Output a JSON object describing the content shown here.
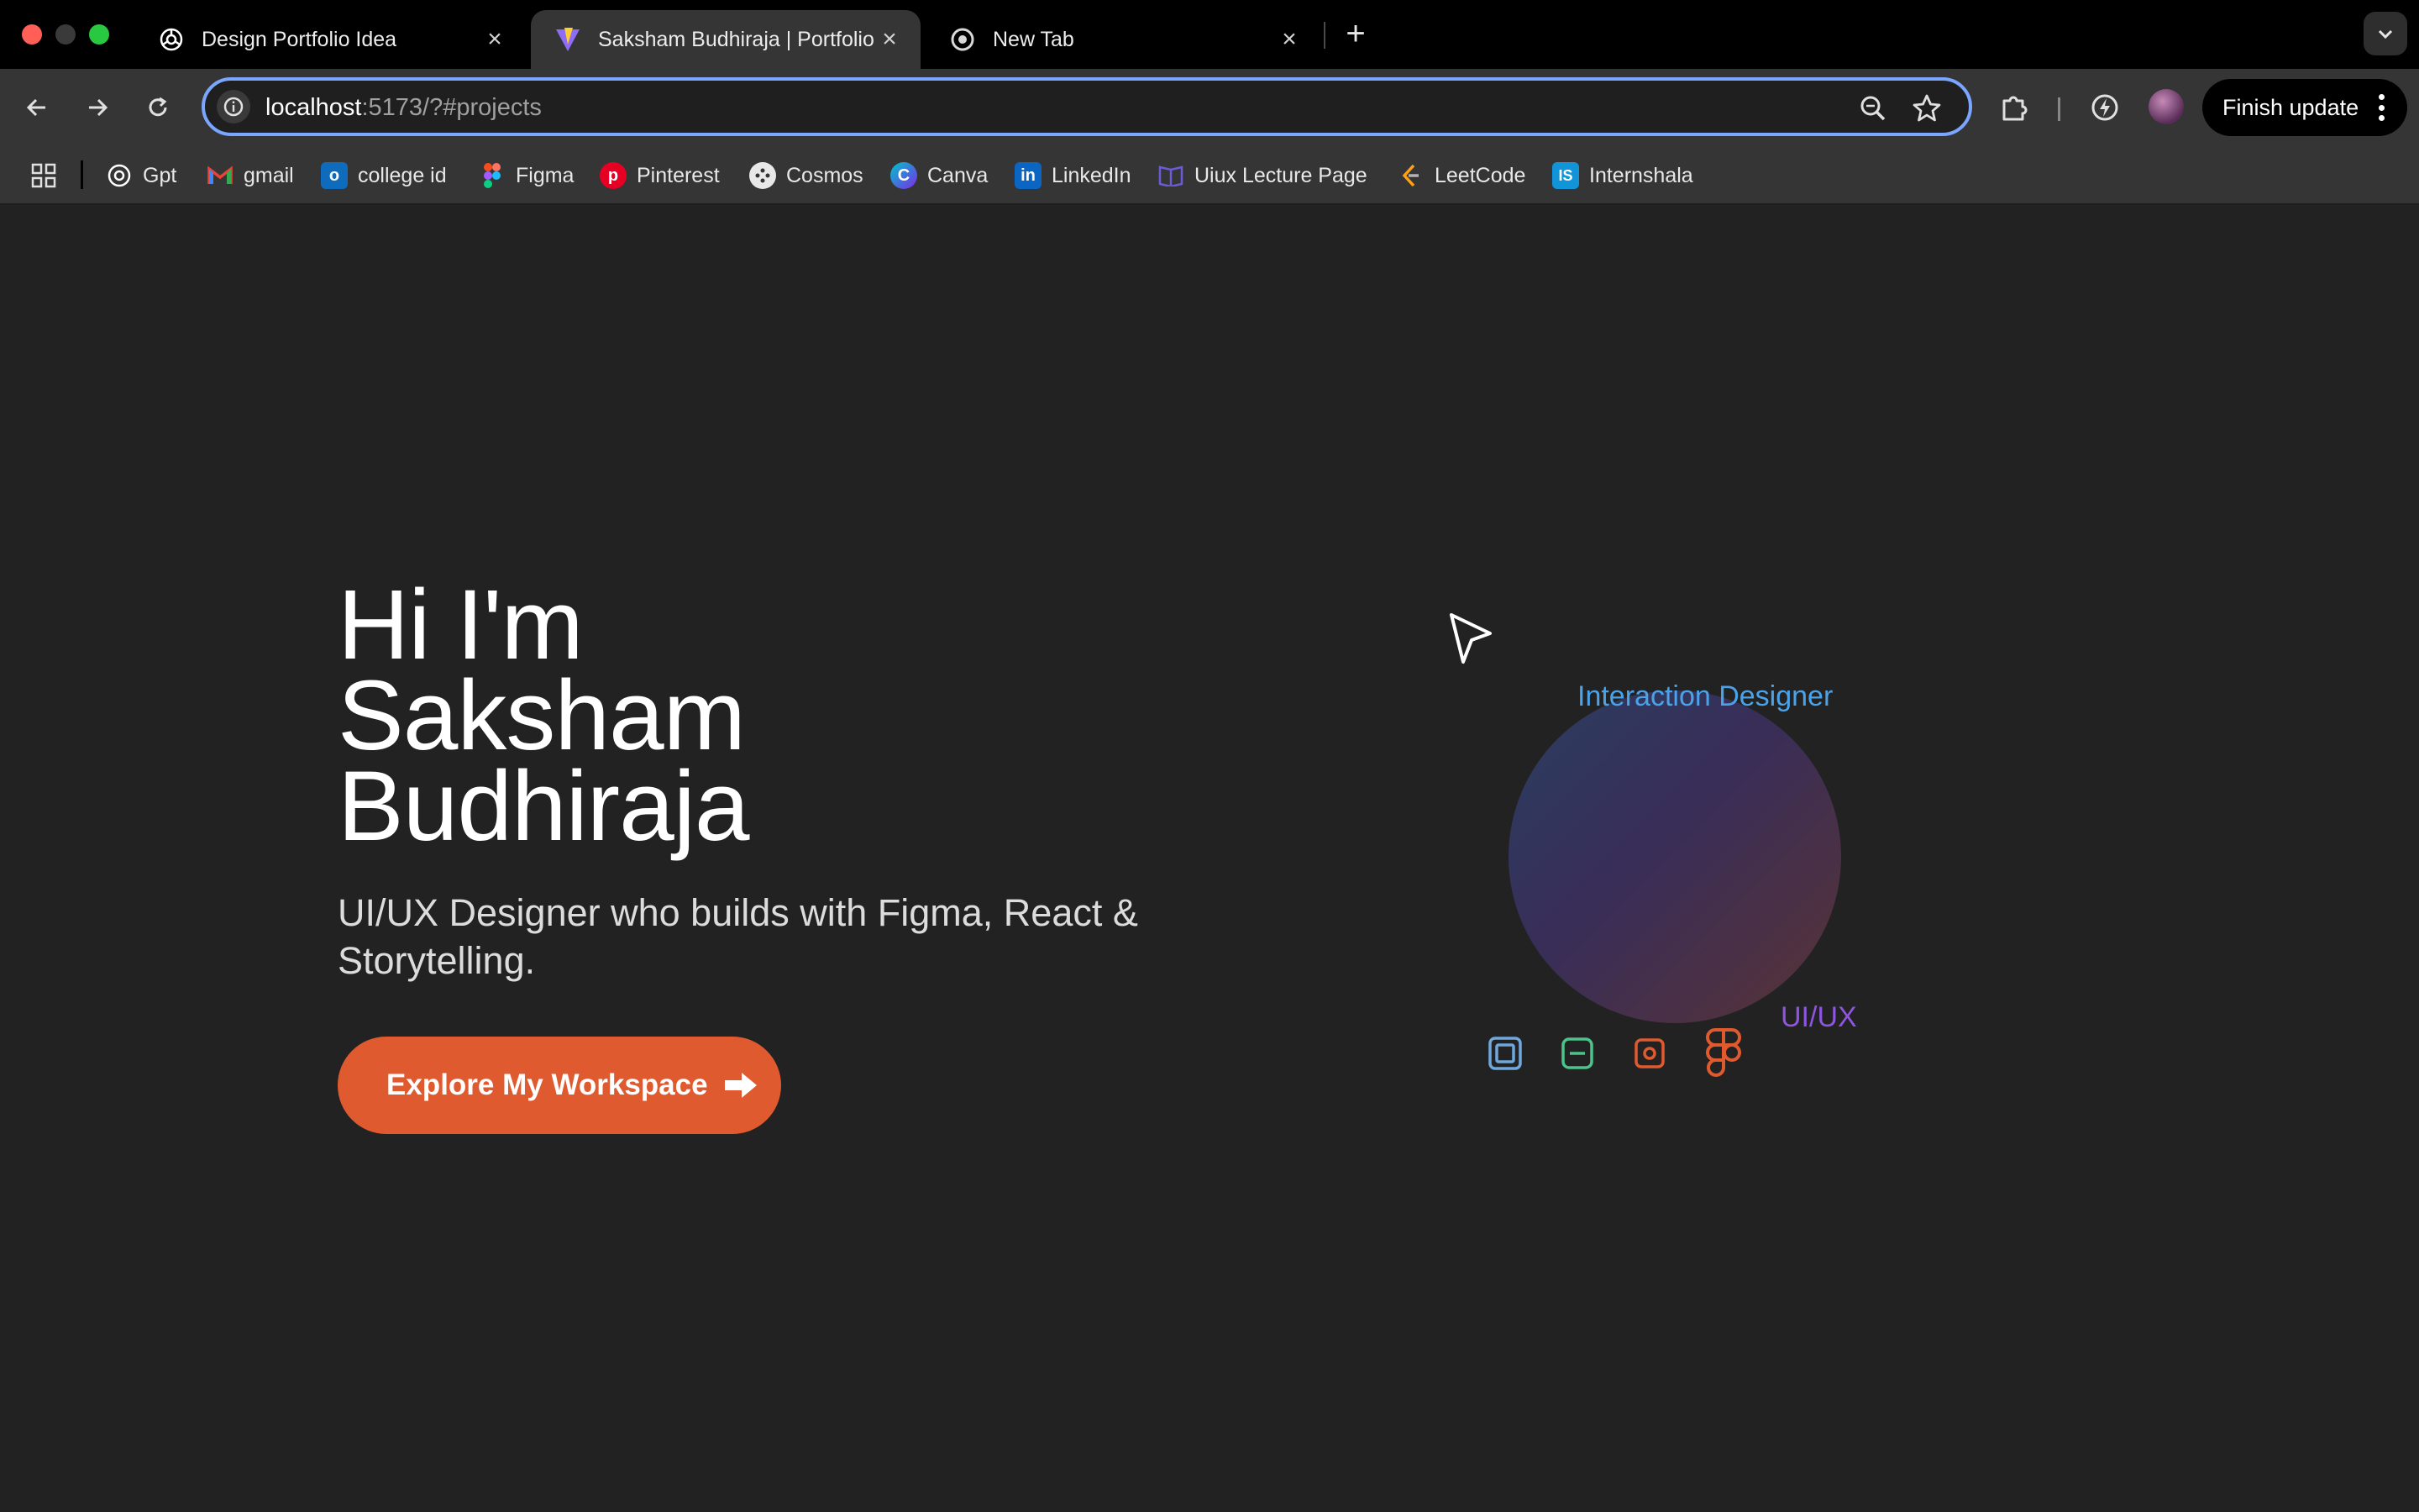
{
  "browser": {
    "tabs": [
      {
        "title": "Design Portfolio Idea",
        "favicon": "openai-icon",
        "active": false
      },
      {
        "title": "Saksham Budhiraja | Portfolio",
        "favicon": "vite-icon",
        "active": true
      },
      {
        "title": "New Tab",
        "favicon": "chrome-icon",
        "active": false
      }
    ],
    "url_host": "localhost",
    "url_rest": ":5173/?#projects",
    "finish_update_label": "Finish update",
    "bookmarks": [
      {
        "label": "Gpt",
        "icon": "openai-icon",
        "color": "#ffffff"
      },
      {
        "label": "gmail",
        "icon": "gmail-icon",
        "color": "#ea4335"
      },
      {
        "label": "college id",
        "icon": "outlook-icon",
        "color": "#0f6cbd"
      },
      {
        "label": "Figma",
        "icon": "figma-icon",
        "color": "#f24e1e"
      },
      {
        "label": "Pinterest",
        "icon": "pinterest-icon",
        "color": "#e60023"
      },
      {
        "label": "Cosmos",
        "icon": "cosmos-icon",
        "color": "#ffffff"
      },
      {
        "label": "Canva",
        "icon": "canva-icon",
        "color": "#7d2ae8"
      },
      {
        "label": "LinkedIn",
        "icon": "linkedin-icon",
        "color": "#0a66c2"
      },
      {
        "label": "Uiux Lecture Page",
        "icon": "book-icon",
        "color": "#6b5bd6"
      },
      {
        "label": "LeetCode",
        "icon": "leetcode-icon",
        "color": "#ffa116"
      },
      {
        "label": "Internshala",
        "icon": "internshala-icon",
        "color": "#1295d8"
      }
    ]
  },
  "hero": {
    "line1": "Hi I'm",
    "line2": "Saksham",
    "line3": "Budhiraja",
    "subtitle": "UI/UX Designer who builds with Figma, React & Storytelling.",
    "cta_label": "Explore My Workspace"
  },
  "visual": {
    "label_top": "Interaction Designer",
    "label_bottom": "UI/UX",
    "tool_icons": [
      {
        "name": "frame-icon",
        "color": "#6fa8dc"
      },
      {
        "name": "component-icon",
        "color": "#4cc38a"
      },
      {
        "name": "target-icon",
        "color": "#e05a2f"
      },
      {
        "name": "figma-logo-icon",
        "color": "#e05a2f"
      }
    ]
  },
  "colors": {
    "page_bg": "#222222",
    "accent": "#e05a2f",
    "chrome_bg": "#353535",
    "tabbar_bg": "#000000",
    "focus_ring": "#7aa6ff"
  }
}
